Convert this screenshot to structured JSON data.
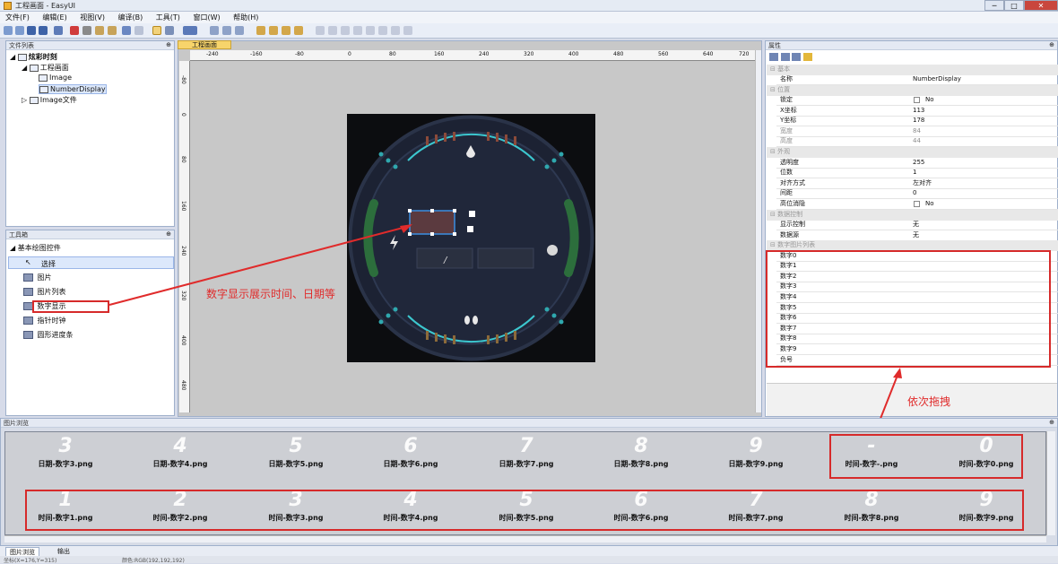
{
  "app": {
    "title": "工程画面 - EasyUI",
    "minimize": "─",
    "maximize": "□",
    "close": "✕"
  },
  "menu": [
    "文件(F)",
    "编辑(E)",
    "视图(V)",
    "编译(B)",
    "工具(T)",
    "窗口(W)",
    "帮助(H)"
  ],
  "file_list": {
    "title": "文件列表",
    "root": "炫彩时刻",
    "screen": "工程画面",
    "children": [
      "Image",
      "NumberDisplay"
    ],
    "image_files": "Image文件"
  },
  "toolbox": {
    "title": "工具箱",
    "group": "基本绘图控件",
    "items": [
      "选择",
      "图片",
      "图片列表",
      "数字显示",
      "指针时钟",
      "圆形进度条"
    ]
  },
  "document": {
    "tab": "工程画面",
    "ruler_h": [
      "-240",
      "-160",
      "-80",
      "0",
      "80",
      "160",
      "240",
      "320",
      "400",
      "480",
      "560",
      "640",
      "720"
    ],
    "ruler_v": [
      "-80",
      "0",
      "80",
      "160",
      "240",
      "320",
      "400",
      "480"
    ],
    "annotation": "数字显示展示时间、日期等"
  },
  "properties": {
    "title": "属性",
    "categories": {
      "basic": "基本",
      "position": "位置",
      "appearance": "外观",
      "display_control": "数据控制",
      "digits": "数字图片列表"
    },
    "rows": {
      "name": {
        "k": "名称",
        "v": "NumberDisplay"
      },
      "lock": {
        "k": "锁定",
        "v": "No"
      },
      "x": {
        "k": "X坐标",
        "v": "113"
      },
      "y": {
        "k": "Y坐标",
        "v": "178"
      },
      "w": {
        "k": "宽度",
        "v": "84"
      },
      "h": {
        "k": "高度",
        "v": "44"
      },
      "opacity": {
        "k": "透明度",
        "v": "255"
      },
      "digits": {
        "k": "位数",
        "v": "1"
      },
      "align": {
        "k": "对齐方式",
        "v": "左对齐"
      },
      "spacing": {
        "k": "间距",
        "v": "0"
      },
      "zero": {
        "k": "高位消隐",
        "v": "No"
      },
      "show_ctrl": {
        "k": "显示控制",
        "v": "无"
      },
      "source": {
        "k": "数据源",
        "v": "无"
      }
    },
    "digit_rows": [
      "数字0",
      "数字1",
      "数字2",
      "数字3",
      "数字4",
      "数字5",
      "数字6",
      "数字7",
      "数字8",
      "数字9",
      "负号"
    ],
    "drag_note": "依次拖拽"
  },
  "gallery": {
    "title": "图片浏览",
    "row1": [
      {
        "digit": "3",
        "file": "日期-数字3.png"
      },
      {
        "digit": "4",
        "file": "日期-数字4.png"
      },
      {
        "digit": "5",
        "file": "日期-数字5.png"
      },
      {
        "digit": "6",
        "file": "日期-数字6.png"
      },
      {
        "digit": "7",
        "file": "日期-数字7.png"
      },
      {
        "digit": "8",
        "file": "日期-数字8.png"
      },
      {
        "digit": "9",
        "file": "日期-数字9.png"
      },
      {
        "digit": "-",
        "file": "时间-数字-.png"
      },
      {
        "digit": "0",
        "file": "时间-数字0.png"
      }
    ],
    "row2": [
      {
        "digit": "1",
        "file": "时间-数字1.png"
      },
      {
        "digit": "2",
        "file": "时间-数字2.png"
      },
      {
        "digit": "3",
        "file": "时间-数字3.png"
      },
      {
        "digit": "4",
        "file": "时间-数字4.png"
      },
      {
        "digit": "5",
        "file": "时间-数字5.png"
      },
      {
        "digit": "6",
        "file": "时间-数字6.png"
      },
      {
        "digit": "7",
        "file": "时间-数字7.png"
      },
      {
        "digit": "8",
        "file": "时间-数字8.png"
      },
      {
        "digit": "9",
        "file": "时间-数字9.png"
      }
    ]
  },
  "bottom_tabs": [
    "图片浏览",
    "输出"
  ],
  "status": {
    "coords": "坐标(X=176,Y=315)",
    "color": "颜色:RGB(192,192,192)"
  },
  "colors": {
    "accent_red": "#d62a2a",
    "teal": "#35c3c9",
    "green": "#2b6b3a"
  }
}
